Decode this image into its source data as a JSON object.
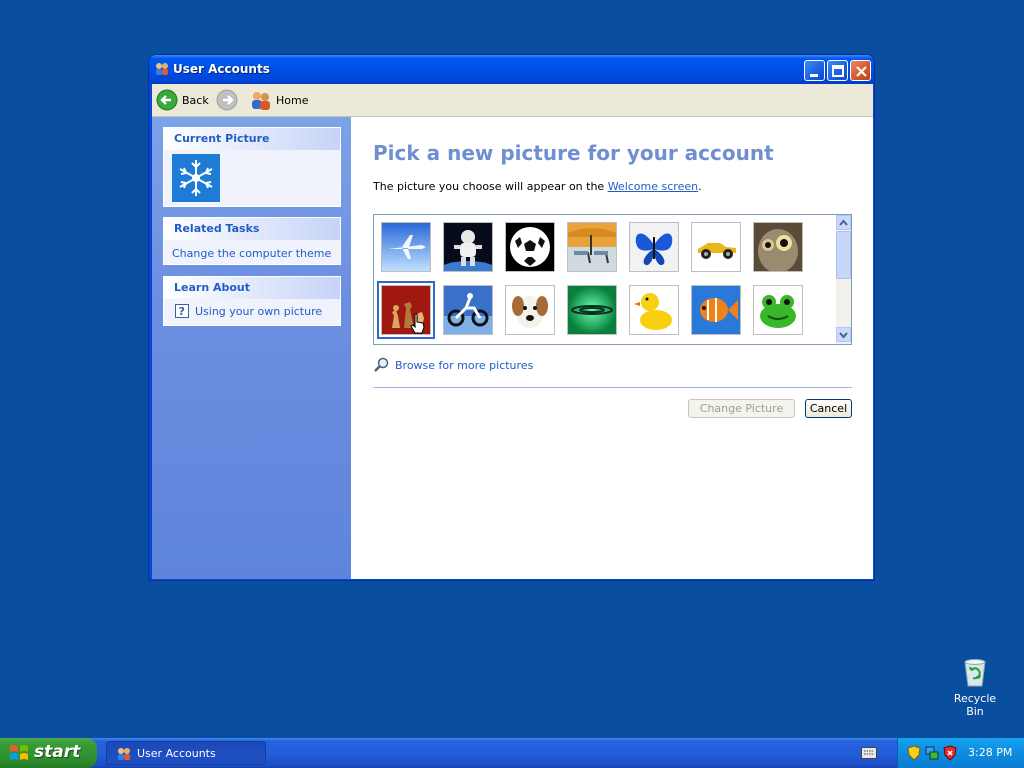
{
  "window": {
    "title": "User Accounts"
  },
  "toolbar": {
    "back_label": "Back",
    "home_label": "Home"
  },
  "taskpane": {
    "current_picture_title": "Current Picture",
    "related_tasks_title": "Related Tasks",
    "related_tasks": [
      "Change the computer theme"
    ],
    "learn_about_title": "Learn About",
    "learn_about": [
      "Using your own picture"
    ]
  },
  "main": {
    "heading": "Pick a new picture for your account",
    "description_prefix": "The picture you choose will appear on the ",
    "description_link": "Welcome screen",
    "description_suffix": ".",
    "browse_label": "Browse for more pictures",
    "change_picture_label": "Change Picture",
    "cancel_label": "Cancel",
    "pictures": [
      {
        "name": "airplane",
        "row": 1
      },
      {
        "name": "astronaut",
        "row": 1
      },
      {
        "name": "soccer-ball",
        "row": 1
      },
      {
        "name": "beach-chairs",
        "row": 1
      },
      {
        "name": "butterfly",
        "row": 1
      },
      {
        "name": "race-car",
        "row": 1
      },
      {
        "name": "owl",
        "row": 1
      },
      {
        "name": "chess",
        "row": 2,
        "selected": true
      },
      {
        "name": "dirt-bike",
        "row": 2
      },
      {
        "name": "dog",
        "row": 2
      },
      {
        "name": "green-ripple",
        "row": 2
      },
      {
        "name": "rubber-duck",
        "row": 2
      },
      {
        "name": "fish",
        "row": 2
      },
      {
        "name": "frog",
        "row": 2
      }
    ]
  },
  "desktop": {
    "recycle_bin_label": "Recycle Bin"
  },
  "taskbar": {
    "start_label": "start",
    "task_button_label": "User Accounts",
    "clock": "3:28 PM"
  },
  "colors": {
    "desktop": "#0a4ea0",
    "title_bar": "#0050e6",
    "link": "#215dc6",
    "heading": "#6f8fd0"
  }
}
